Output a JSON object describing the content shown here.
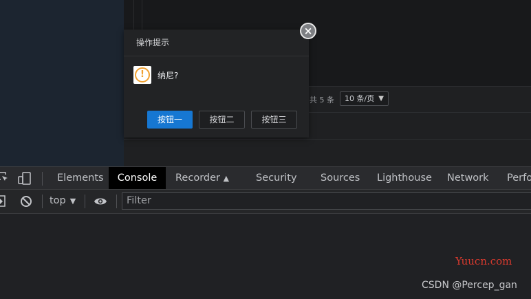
{
  "pager": {
    "total": "共 5 条",
    "page_size": "10 条/页"
  },
  "dialog": {
    "title": "操作提示",
    "message": "纳尼?",
    "close_glyph": "×",
    "icon": "warning-icon",
    "warning_glyph": "!",
    "buttons": [
      "按钮一",
      "按钮二",
      "按钮三"
    ],
    "primary_color": "#1677d2"
  },
  "devtools": {
    "tabs": [
      "Elements",
      "Console",
      "Recorder",
      "Security",
      "Sources",
      "Lighthouse",
      "Network",
      "Perfo"
    ],
    "active_tab": "Console",
    "recorder_flask": "▲",
    "context": "top",
    "filter_placeholder": "Filter"
  },
  "watermark": {
    "site": "Yuucn.com",
    "author": "CSDN @Percep_gan"
  }
}
